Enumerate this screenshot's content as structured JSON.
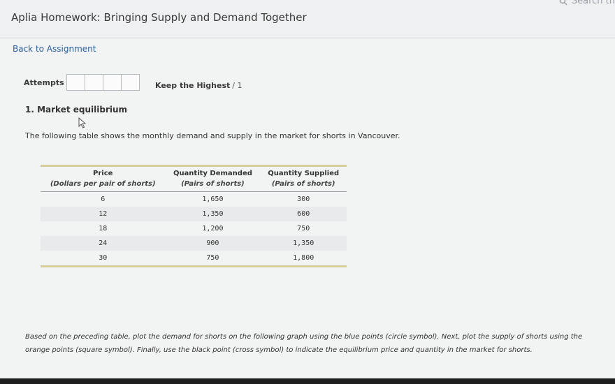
{
  "header": {
    "title": "Aplia Homework: Bringing Supply and Demand Together",
    "search_placeholder": "Search th"
  },
  "nav": {
    "back_label": "Back to Assignment"
  },
  "attempts": {
    "label": "Attempts",
    "boxes": [
      "",
      "",
      "",
      ""
    ],
    "keep_label": "Keep the Highest",
    "score": "/ 1"
  },
  "question": {
    "title": "1. Market equilibrium",
    "intro": "The following table shows the monthly demand and supply in the market for shorts in Vancouver.",
    "instructions": "Based on the preceding table, plot the demand for shorts on the following graph using the blue points (circle symbol). Next, plot the supply of shorts using the orange points (square symbol). Finally, use the black point (cross symbol) to indicate the equilibrium price and quantity in the market for shorts."
  },
  "table": {
    "headers": [
      "Price",
      "Quantity Demanded",
      "Quantity Supplied"
    ],
    "subheaders": [
      "(Dollars per pair of shorts)",
      "(Pairs of shorts)",
      "(Pairs of shorts)"
    ],
    "rows": [
      [
        "6",
        "1,650",
        "300"
      ],
      [
        "12",
        "1,350",
        "600"
      ],
      [
        "18",
        "1,200",
        "750"
      ],
      [
        "24",
        "900",
        "1,350"
      ],
      [
        "30",
        "750",
        "1,800"
      ]
    ]
  }
}
